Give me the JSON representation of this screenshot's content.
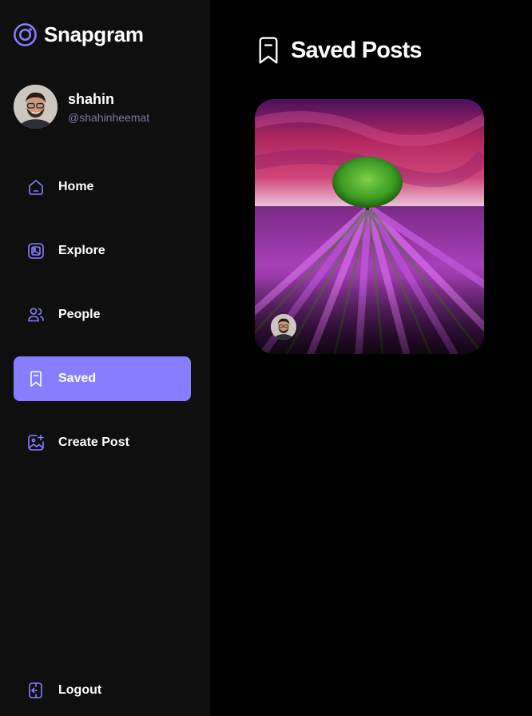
{
  "app": {
    "name": "Snapgram"
  },
  "user": {
    "name": "shahin",
    "handle": "@shahinheemat"
  },
  "nav": {
    "items": [
      {
        "label": "Home",
        "icon": "home-icon",
        "active": false
      },
      {
        "label": "Explore",
        "icon": "explore-icon",
        "active": false
      },
      {
        "label": "People",
        "icon": "people-icon",
        "active": false
      },
      {
        "label": "Saved",
        "icon": "bookmark-icon",
        "active": true
      },
      {
        "label": "Create Post",
        "icon": "gallery-add-icon",
        "active": false
      }
    ],
    "logout_label": "Logout"
  },
  "page": {
    "title": "Saved Posts",
    "icon": "bookmark-icon"
  },
  "colors": {
    "accent": "#877eff",
    "sidebar_bg": "#0f0f0f",
    "page_bg": "#000000",
    "handle": "#7878a3"
  }
}
